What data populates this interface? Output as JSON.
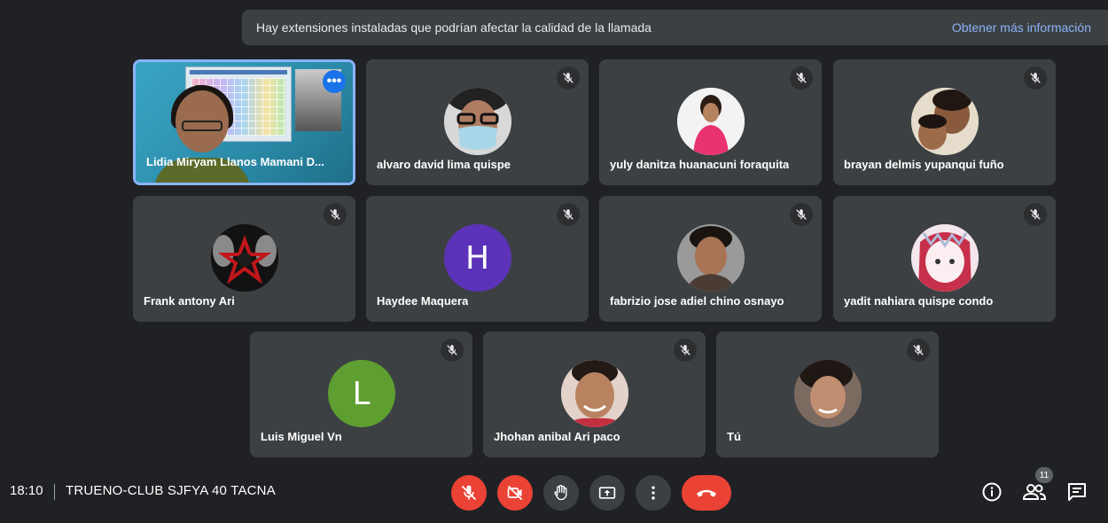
{
  "banner": {
    "message": "Hay extensiones instaladas que podrían afectar la calidad de la llamada",
    "link": "Obtener más información"
  },
  "participants": [
    {
      "name": "Lidia Miryam Llanos Mamani D...",
      "type": "video",
      "muted": false,
      "active": true
    },
    {
      "name": "alvaro david lima quispe",
      "type": "photo",
      "muted": true
    },
    {
      "name": "yuly danitza huanacuni foraquita",
      "type": "photo",
      "muted": true
    },
    {
      "name": "brayan delmis yupanqui fuño",
      "type": "photo",
      "muted": true
    },
    {
      "name": "Frank antony Ari",
      "type": "photo",
      "muted": true
    },
    {
      "name": "Haydee Maquera",
      "type": "letter",
      "letter": "H",
      "color": "#5c33b8",
      "muted": true
    },
    {
      "name": "fabrizio jose adiel chino osnayo",
      "type": "photo",
      "muted": true
    },
    {
      "name": "yadit nahiara quispe condo",
      "type": "photo",
      "muted": true
    },
    {
      "name": "Luis Miguel Vn",
      "type": "letter",
      "letter": "L",
      "color": "#5f9e31",
      "muted": true
    },
    {
      "name": "Jhohan anibal Ari paco",
      "type": "photo",
      "muted": true
    },
    {
      "name": "Tú",
      "type": "photo",
      "muted": true
    }
  ],
  "bottom_bar": {
    "time": "18:10",
    "meeting_name": "TRUENO-CLUB SJFYA 40 TACNA",
    "participant_count": "11",
    "controls": [
      "mic-off-icon",
      "camera-off-icon",
      "raise-hand-icon",
      "present-screen-icon",
      "more-options-icon",
      "end-call-icon"
    ],
    "right_icons": [
      "info-icon",
      "people-icon",
      "chat-icon"
    ]
  },
  "colors": {
    "background": "#202124",
    "tile": "#3c4043",
    "accent": "#8ab4f8",
    "danger": "#ea4335"
  }
}
